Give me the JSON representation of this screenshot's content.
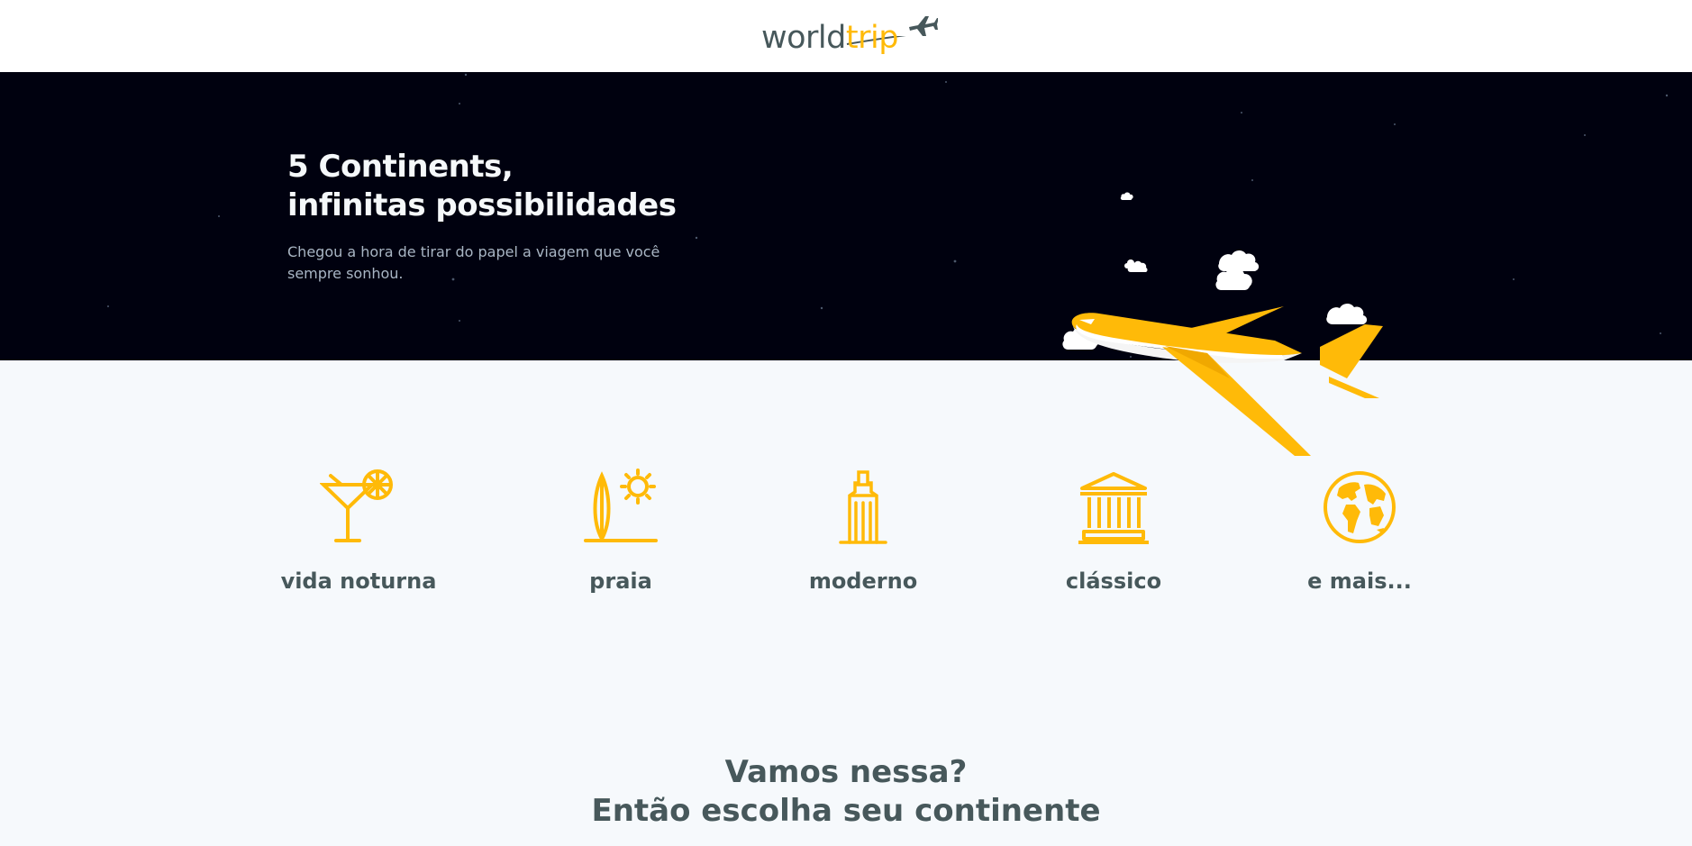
{
  "header": {
    "logo_main": "world",
    "logo_accent": "trip"
  },
  "hero": {
    "title_line1": "5 Continents,",
    "title_line2": "infinitas possibilidades",
    "subtitle": "Chegou a hora de tirar do papel a viagem que você sempre sonhou."
  },
  "travel_types": [
    {
      "label": "vida noturna",
      "icon": "cocktail-icon"
    },
    {
      "label": "praia",
      "icon": "surf-sun-icon"
    },
    {
      "label": "moderno",
      "icon": "building-icon"
    },
    {
      "label": "clássico",
      "icon": "museum-icon"
    },
    {
      "label": "e mais...",
      "icon": "earth-globe-icon"
    }
  ],
  "cta": {
    "line1": "Vamos nessa?",
    "line2": "Então escolha seu continente"
  },
  "colors": {
    "accent": "#ffba08",
    "text_dark": "#47585b",
    "banner_bg": "#00010f",
    "page_bg": "#f6f9fc",
    "hero_text": "#f5f8fa",
    "hero_subtext": "#a9b6c4"
  }
}
